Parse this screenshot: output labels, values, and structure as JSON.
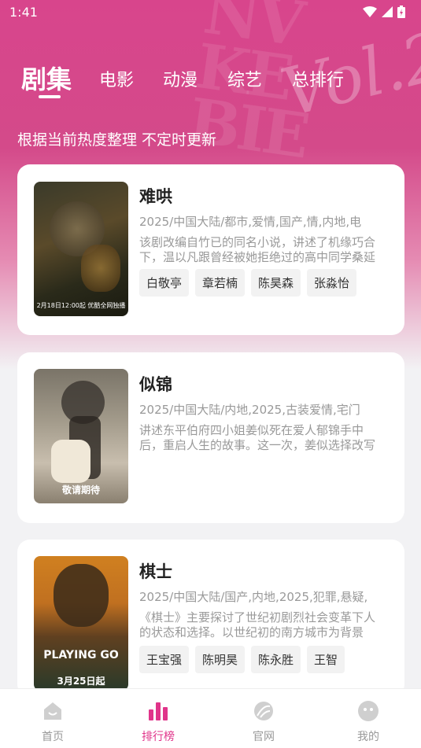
{
  "status_bar": {
    "time": "1:41"
  },
  "tabs": [
    {
      "label": "剧集",
      "active": true
    },
    {
      "label": "电影",
      "active": false
    },
    {
      "label": "动漫",
      "active": false
    },
    {
      "label": "综艺",
      "active": false
    },
    {
      "label": "总排行",
      "active": false
    }
  ],
  "subtitle": "根据当前热度整理 不定时更新",
  "cards": [
    {
      "title": "难哄",
      "meta": "2025/中国大陆/都市,爱情,国产,情,内地,电",
      "desc": "该剧改编自竹已的同名小说，讲述了机缘巧合下，温以凡跟曾经被她拒绝过的高中同学桑延重逢的故事",
      "poster_caption": "2月18日12:00起 优酷全网独播",
      "cast": [
        "白敬亭",
        "章若楠",
        "陈昊森",
        "张淼怡"
      ]
    },
    {
      "title": "似锦",
      "meta": "2025/中国大陆/内地,2025,古装爱情,宅门",
      "desc": "讲述东平伯府四小姐姜似死在爱人郁锦手中后，重启人生的故事。这一次，姜似选择改写命运",
      "poster_caption": "敬请期待",
      "cast": []
    },
    {
      "title": "棋士",
      "meta": "2025/中国大陆/国产,内地,2025,犯罪,悬疑,",
      "desc": "《棋士》主要探讨了世纪初剧烈社会变革下人的状态和选择。以世纪初的南方城市为背景",
      "poster_caption": "3月25日起",
      "poster_title": "PLAYING GO",
      "cast": [
        "王宝强",
        "陈明昊",
        "陈永胜",
        "王智"
      ]
    }
  ],
  "bottom_nav": [
    {
      "label": "首页",
      "icon": "home-icon",
      "active": false
    },
    {
      "label": "排行榜",
      "icon": "ranking-icon",
      "active": true
    },
    {
      "label": "官网",
      "icon": "website-icon",
      "active": false
    },
    {
      "label": "我的",
      "icon": "profile-icon",
      "active": false
    }
  ],
  "colors": {
    "accent": "#e0348a",
    "hero": "#d8458c"
  }
}
